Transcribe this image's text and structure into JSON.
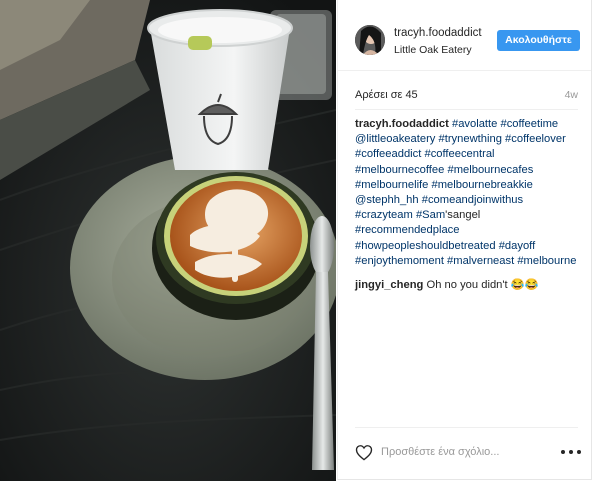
{
  "post": {
    "image_icon": "coffee-cup-photo",
    "author": "tracyh.foodaddict",
    "location": "Little Oak Eatery",
    "follow_label": "Ακολουθήστε",
    "likes_text": "Αρέσει σε 45",
    "time_ago": "4w",
    "caption": {
      "user": "tracyh.foodaddict",
      "tokens": [
        {
          "text": "#avolatte",
          "tag": true
        },
        {
          "text": " ",
          "tag": false
        },
        {
          "text": "#coffeetime",
          "tag": true
        },
        {
          "text": " ",
          "tag": false
        },
        {
          "text": "@littleoakeatery",
          "tag": true
        },
        {
          "text": " ",
          "tag": false
        },
        {
          "text": "#trynewthing",
          "tag": true
        },
        {
          "text": " ",
          "tag": false
        },
        {
          "text": "#coffeelover",
          "tag": true
        },
        {
          "text": " ",
          "tag": false
        },
        {
          "text": "#coffeeaddict",
          "tag": true
        },
        {
          "text": " ",
          "tag": false
        },
        {
          "text": "#coffeecentral",
          "tag": true
        },
        {
          "text": " ",
          "tag": false
        },
        {
          "text": "#melbournecoffee",
          "tag": true
        },
        {
          "text": " ",
          "tag": false
        },
        {
          "text": "#melbournecafes",
          "tag": true
        },
        {
          "text": " ",
          "tag": false
        },
        {
          "text": "#melbournelife",
          "tag": true
        },
        {
          "text": " ",
          "tag": false
        },
        {
          "text": "#melbournebreakkie",
          "tag": true
        },
        {
          "text": " ",
          "tag": false
        },
        {
          "text": "@stephh_hh",
          "tag": true
        },
        {
          "text": " ",
          "tag": false
        },
        {
          "text": "#comeandjoinwithus",
          "tag": true
        },
        {
          "text": " ",
          "tag": false
        },
        {
          "text": "#crazyteam",
          "tag": true
        },
        {
          "text": " ",
          "tag": false
        },
        {
          "text": "#Sam",
          "tag": true
        },
        {
          "text": "'sangel",
          "tag": false
        },
        {
          "text": " ",
          "tag": false
        },
        {
          "text": "#recommendedplace",
          "tag": true
        },
        {
          "text": " ",
          "tag": false
        },
        {
          "text": "#howpeopleshouldbetreated",
          "tag": true
        },
        {
          "text": " ",
          "tag": false
        },
        {
          "text": "#dayoff",
          "tag": true
        },
        {
          "text": " ",
          "tag": false
        },
        {
          "text": "#enjoythemoment",
          "tag": true
        },
        {
          "text": " ",
          "tag": false
        },
        {
          "text": "#malverneast",
          "tag": true
        },
        {
          "text": " ",
          "tag": false
        },
        {
          "text": "#melbourne",
          "tag": true
        }
      ]
    },
    "comment": {
      "user": "jingyi_cheng",
      "text": "Oh no you didn't 😂😂"
    },
    "comment_placeholder": "Προσθέστε ένα σχόλιο...",
    "like_icon": "heart-outline-icon",
    "more_icon": "more-options-icon",
    "colors": {
      "follow_button": "#3897f0",
      "hashtag": "#003569",
      "text": "#262626",
      "muted": "#999999"
    }
  }
}
